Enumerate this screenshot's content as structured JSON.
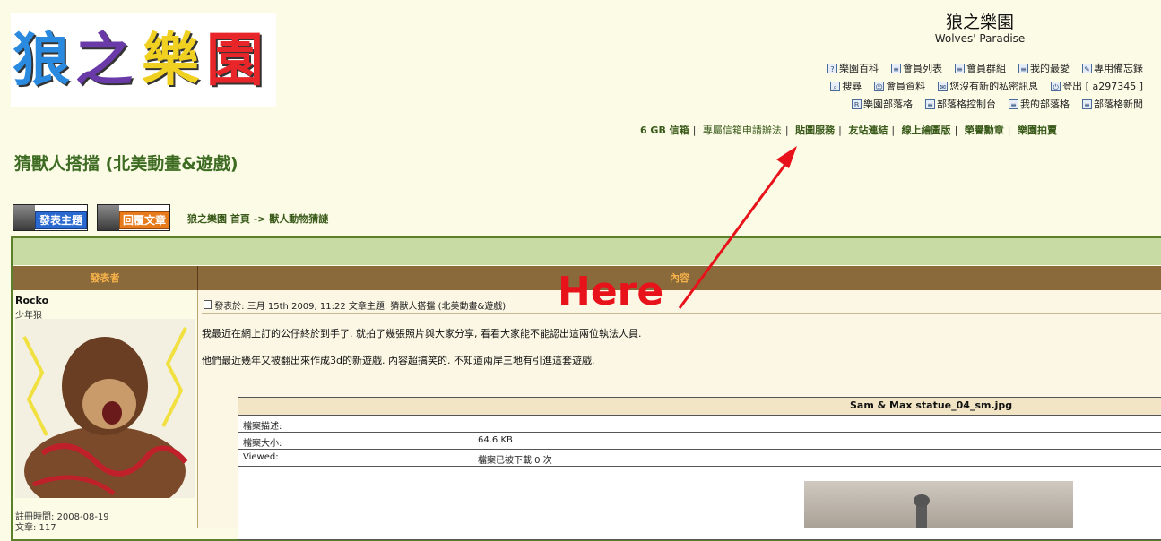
{
  "header": {
    "title": "狼之樂園",
    "subtitle": "Wolves' Paradise",
    "logo_chars": [
      "狼",
      "之",
      "樂",
      "園"
    ]
  },
  "nav": {
    "row1": [
      {
        "icon": "help-icon",
        "label": "樂園百科"
      },
      {
        "icon": "list-icon",
        "label": "會員列表"
      },
      {
        "icon": "list-icon",
        "label": "會員群組"
      },
      {
        "icon": "list-icon",
        "label": "我的最愛"
      },
      {
        "icon": "memo-icon",
        "label": "專用備忘錄"
      }
    ],
    "row2": [
      {
        "icon": "search-icon",
        "label": "搜尋"
      },
      {
        "icon": "profile-icon",
        "label": "會員資料"
      },
      {
        "icon": "message-icon",
        "label": "您沒有新的私密訊息"
      },
      {
        "icon": "logout-icon",
        "label": "登出 [ a297345 ]"
      }
    ],
    "row3": [
      {
        "icon": "blog-icon",
        "label": "樂園部落格"
      },
      {
        "icon": "list-icon",
        "label": "部落格控制台"
      },
      {
        "icon": "list-icon",
        "label": "我的部落格"
      },
      {
        "icon": "list-icon",
        "label": "部落格新聞"
      }
    ]
  },
  "links_bar": [
    "6 GB 信箱",
    "專屬信箱申請辦法",
    "貼圖服務",
    "友站連結",
    "線上繪圖版",
    "榮譽勳章",
    "樂園拍賣"
  ],
  "topic_title": "猜獸人搭擋 (北美動畫&遊戲)",
  "buttons": {
    "new_topic": "發表主題",
    "reply": "回覆文章"
  },
  "breadcrumb": "狼之樂園 首頁 -> 獸人動物猜謎",
  "table_header": {
    "author": "發表者",
    "content": "內容"
  },
  "post": {
    "author": "Rocko",
    "rank": "少年狼",
    "join_date": "註冊時間: 2008-08-19",
    "post_count": "文章: 117",
    "meta": "發表於: 三月 15th 2009, 11:22    文章主題: 猜獸人搭擋 (北美動畫&遊戲)",
    "body_1": "我最近在網上訂的公仔終於到手了. 就拍了幾張照片與大家分享, 看看大家能不能認出這兩位執法人員.",
    "body_2": "他們最近幾年又被翻出來作成3d的新遊戲. 內容超搞笑的. 不知道兩岸三地有引進這套遊戲."
  },
  "attachment": {
    "filename": "Sam & Max statue_04_sm.jpg",
    "rows": [
      {
        "label": "檔案描述:",
        "value": ""
      },
      {
        "label": "檔案大小:",
        "value": "64.6 KB"
      },
      {
        "label": "Viewed:",
        "value": "檔案已被下載 0 次"
      }
    ]
  },
  "annotation": {
    "text": "Here",
    "color": "#e8121b"
  }
}
